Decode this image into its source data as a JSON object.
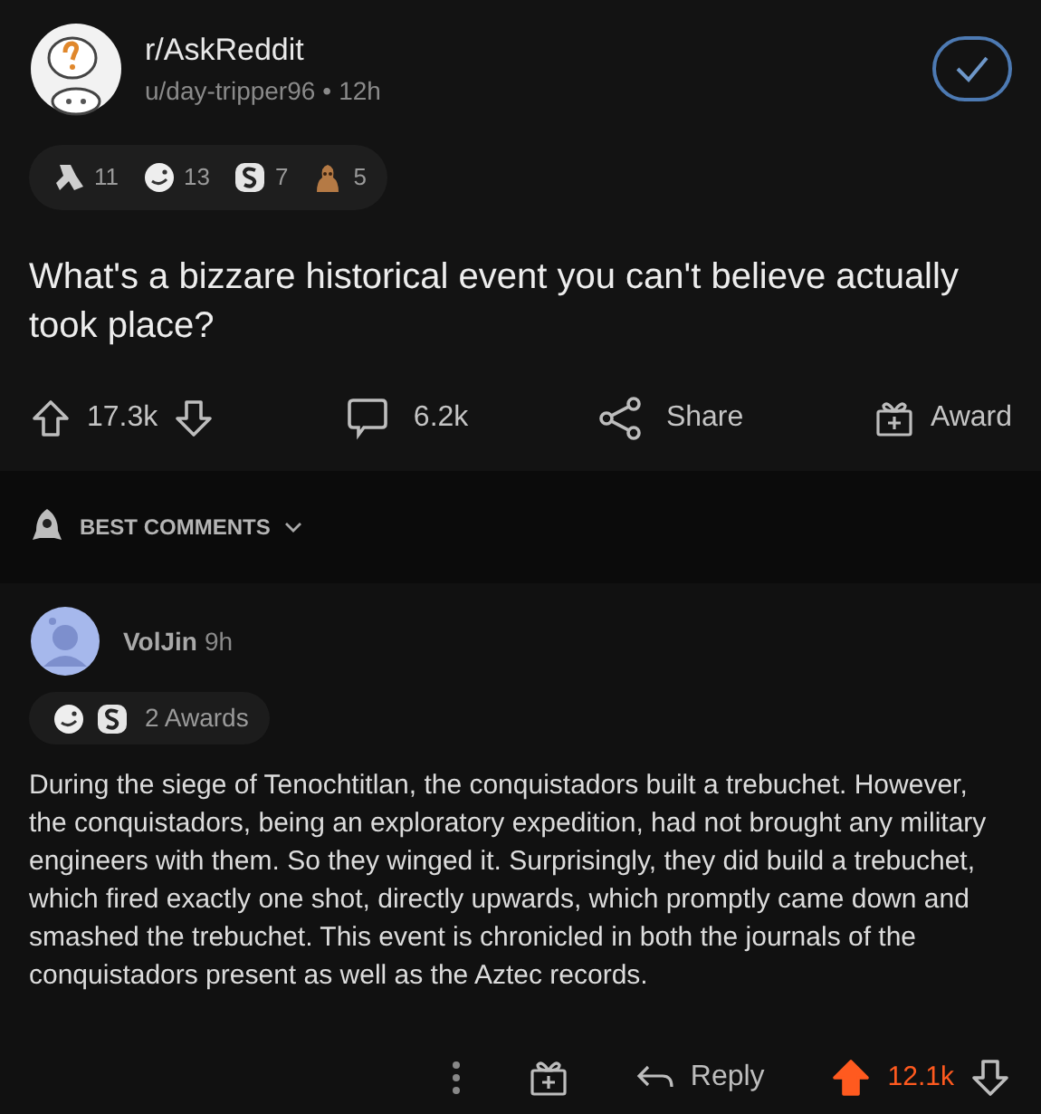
{
  "post": {
    "subreddit": "r/AskReddit",
    "author": "u/day-tripper96",
    "separator": "•",
    "age": "12h",
    "joined": true,
    "awards": [
      {
        "kind": "ribbon",
        "count": "11"
      },
      {
        "kind": "face",
        "count": "13"
      },
      {
        "kind": "coin",
        "count": "7"
      },
      {
        "kind": "bust",
        "count": "5"
      }
    ],
    "title": "What's a bizzare historical event you can't believe actually took place?",
    "votes": "17.3k",
    "comments": "6.2k",
    "share": "Share",
    "award": "Award"
  },
  "sort": {
    "label": "BEST COMMENTS"
  },
  "comment": {
    "author": "VolJin",
    "age": "9h",
    "awards": [
      {
        "kind": "face"
      },
      {
        "kind": "coin"
      }
    ],
    "awards_label": "2 Awards",
    "body": "During the siege of Tenochtitlan, the conquistadors built a trebuchet. However, the conquistadors, being an exploratory expedition, had not brought any military engineers with them. So they winged it. Surprisingly, they did build a trebuchet, which fired exactly one shot, directly upwards, which promptly came down and smashed the trebuchet. This event is chronicled in both the journals of the conquistadors present as well as the Aztec records.",
    "reply": "Reply",
    "votes": "12.1k",
    "upvoted": true
  }
}
